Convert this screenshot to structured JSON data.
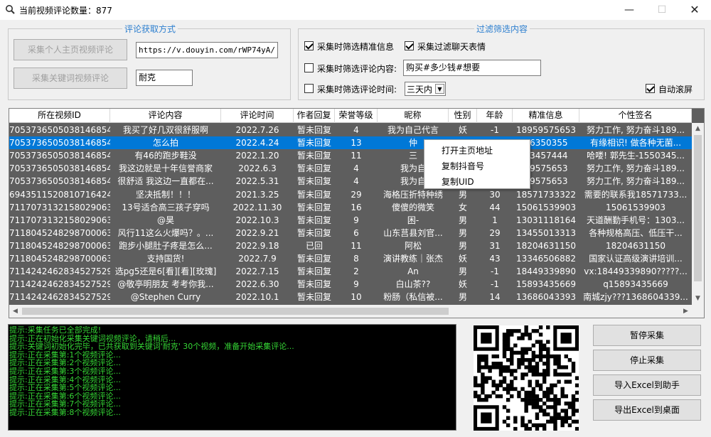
{
  "window": {
    "title": "当前视频评论数量：877",
    "icon": "magnifier-icon",
    "controls": [
      "minimize-icon",
      "maximize-icon",
      "close-icon"
    ]
  },
  "fetch_group": {
    "title": "评论获取方式",
    "btn_personal": "采集个人主页视频评论",
    "btn_keyword": "采集关键词视频评论",
    "url_value": "https://v.douyin.com/rWP74yA/",
    "keyword_value": "耐克"
  },
  "filter_group": {
    "title": "过滤筛选内容",
    "precise_label": "采集时筛选精准信息",
    "precise_checked": true,
    "emoji_label": "采集过滤聊天表情",
    "emoji_checked": true,
    "comment_label": "采集时筛选评论内容:",
    "comment_checked": false,
    "comment_value": "购买#多少钱#想要",
    "time_label": "采集时筛选评论时间:",
    "time_checked": false,
    "time_value": "三天内",
    "autoscroll_label": "自动滚屏",
    "autoscroll_checked": true
  },
  "table": {
    "columns": [
      "所在视频ID",
      "评论内容",
      "评论时间",
      "作者回复",
      "荣誉等级",
      "昵称",
      "性别",
      "年龄",
      "精准信息",
      "个性签名"
    ],
    "selected_index": 1,
    "rows": [
      [
        "7053736505038146854",
        "我买了好几双很舒服啊",
        "2022.7.26",
        "暂未回复",
        "4",
        "我为自己代言",
        "妖",
        "-1",
        "18959575653",
        "努力工作, 努力奋斗189..."
      ],
      [
        "7053736505038146854",
        "怎么拍",
        "2022.4.24",
        "暂未回复",
        "13",
        "仲",
        "",
        "",
        "06350355",
        "有缘相识! 做各种无菌..."
      ],
      [
        "7053736505038146854",
        "有46的跑步鞋没",
        "2022.1.20",
        "暂未回复",
        "11",
        "三",
        "",
        "",
        "03457444",
        "哈喽! 郭先生-1550345..."
      ],
      [
        "7053736505038146854",
        "我这边就是十年信誉商家",
        "2022.6.3",
        "暂未回复",
        "4",
        "我为自",
        "",
        "",
        "59575653",
        "努力工作, 努力奋斗189..."
      ],
      [
        "7053736505038146854",
        "很舒适 我这边一直都在...",
        "2022.5.31",
        "暂未回复",
        "4",
        "我为自",
        "",
        "",
        "59575653",
        "努力工作, 努力奋斗189..."
      ],
      [
        "6943511520810716424",
        "坚决抵制！！！",
        "2021.3.25",
        "暂未回复",
        "29",
        "海格压折特种绣",
        "男",
        "30",
        "18571733322",
        "需要的联系我18571733..."
      ],
      [
        "7117073132158029063",
        "13号适合高三孩子穿吗",
        "2022.11.30",
        "暂未回复",
        "16",
        "傻傻的微笑",
        "女",
        "44",
        "15061539903",
        "15061539903"
      ],
      [
        "7117073132158029063",
        "@昊",
        "2022.10.3",
        "暂未回复",
        "9",
        "困-",
        "男",
        "1",
        "13031118164",
        "天道酬勤手机号：1303..."
      ],
      [
        "7118045248298700063",
        "风行11这么火爆吗？。...",
        "2022.9.21",
        "暂未回复",
        "6",
        "山东莒县刘官...",
        "男",
        "29",
        "13455013313",
        "各种规格高压、低压干..."
      ],
      [
        "7118045248298700063",
        "跑步小腿肚子疼是怎么...",
        "2022.9.18",
        "已回",
        "11",
        "阿松",
        "男",
        "31",
        "18204631150",
        "18204631150"
      ],
      [
        "7118045248298700063",
        "支持国货!",
        "2022.7.9",
        "暂未回复",
        "8",
        "演讲教练｜张杰",
        "妖",
        "43",
        "13346506882",
        "国家认证高级演讲培训..."
      ],
      [
        "7114242462834527529",
        "选pg5还是6[看][看][玫瑰]",
        "2022.7.15",
        "暂未回复",
        "2",
        "An",
        "男",
        "-1",
        "18449339890",
        "vx:18449339890?????..."
      ],
      [
        "7114242462834527529",
        "@敬亭明朋友 考考你我...",
        "2022.6.30",
        "暂未回复",
        "9",
        "白山茶??",
        "妖",
        "-1",
        "15893435669",
        "q15893435669"
      ],
      [
        "7114242462834527529",
        "@Stephen Curry",
        "2022.10.1",
        "暂未回复",
        "10",
        "粉肠（私信被...",
        "男",
        "14",
        "13686043393",
        "南城zjy???1368604339..."
      ]
    ]
  },
  "context_menu": {
    "items": [
      "打开主页地址",
      "复制抖音号",
      "复制UID"
    ]
  },
  "log": {
    "lines": [
      "提示:采集任务已全部完成!",
      "提示:正在初始化采集关键词视频评论，请稍后...",
      "提示:关键词初始化完毕，已共获取到关键词'耐克' 30个视频，准备开始采集评论...",
      "提示:正在采集第:1个视频评论...",
      "提示:正在采集第:2个视频评论...",
      "提示:正在采集第:3个视频评论...",
      "提示:正在采集第:4个视频评论...",
      "提示:正在采集第:5个视频评论...",
      "提示:正在采集第:6个视频评论...",
      "提示:正在采集第:7个视频评论...",
      "提示:正在采集第:8个视频评论..."
    ]
  },
  "actions": {
    "pause": "暂停采集",
    "stop": "停止采集",
    "import_excel": "导入Excel到助手",
    "export_excel": "导出Excel到桌面"
  },
  "colors": {
    "accent_title": "#2d7fcf",
    "table_bg": "#5e5e5e",
    "selected_row": "#0078d7",
    "log_text": "#35d635"
  }
}
